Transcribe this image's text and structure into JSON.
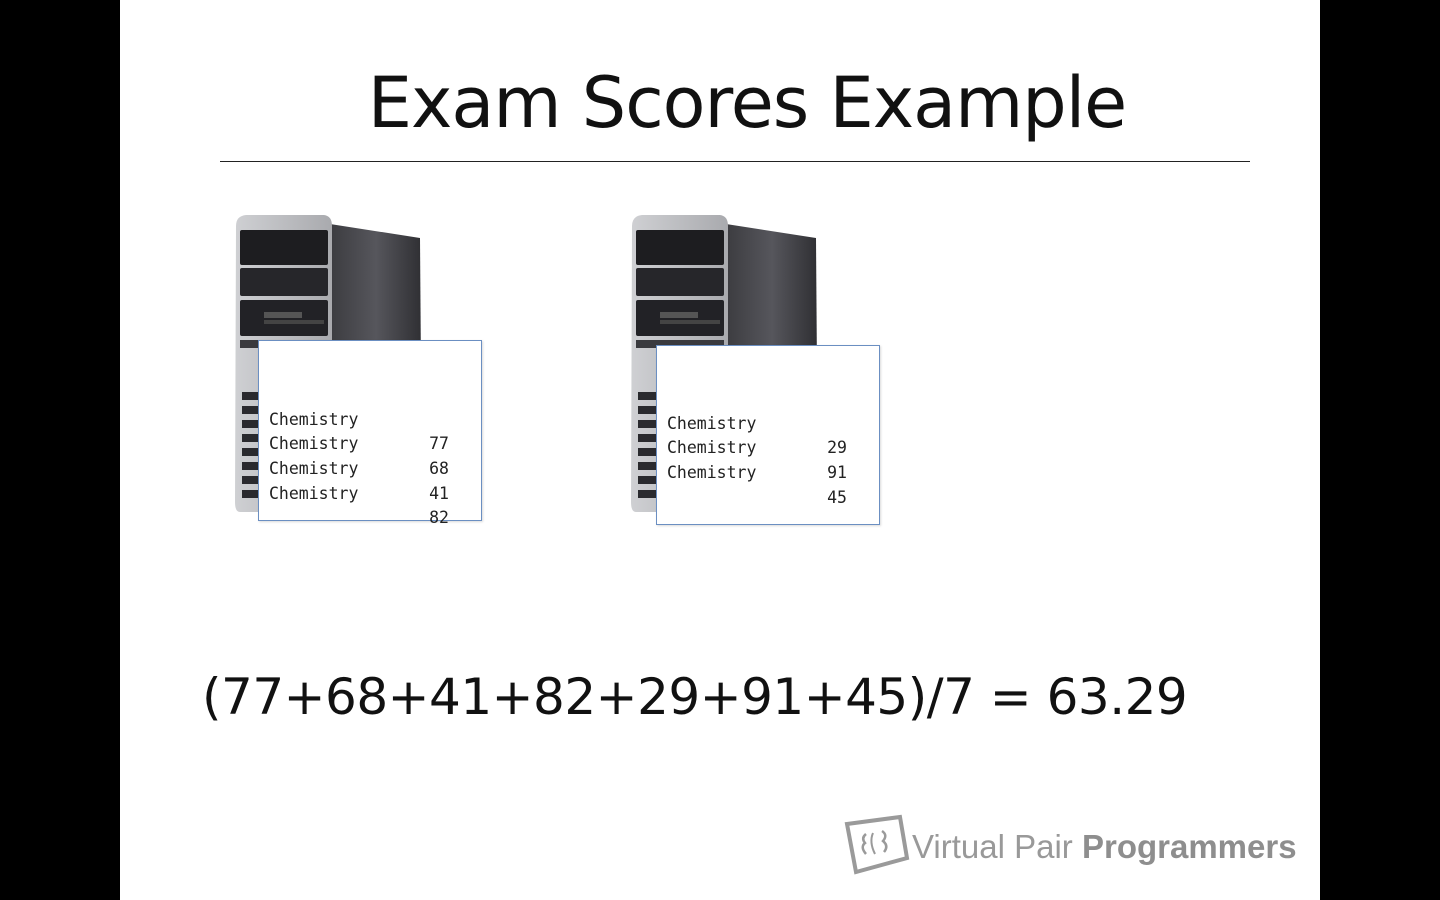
{
  "slide": {
    "title": "Exam Scores Example",
    "formula": "(77+68+41+82+29+91+45)/7 = 63.29"
  },
  "machines": [
    {
      "rows": [
        {
          "subject": "Chemistry",
          "score": "77"
        },
        {
          "subject": "Chemistry",
          "score": "68"
        },
        {
          "subject": "Chemistry",
          "score": "41"
        },
        {
          "subject": "Chemistry",
          "score": "82"
        }
      ]
    },
    {
      "rows": [
        {
          "subject": "Chemistry",
          "score": "29"
        },
        {
          "subject": "Chemistry",
          "score": "91"
        },
        {
          "subject": "Chemistry",
          "score": "45"
        }
      ]
    }
  ],
  "logo": {
    "text_light": "Virtual Pair",
    "text_bold": "Programmers"
  },
  "colors": {
    "background": "#000000",
    "slide": "#ffffff",
    "panel_border": "#6b8fc2",
    "logo_gray": "#999999"
  }
}
